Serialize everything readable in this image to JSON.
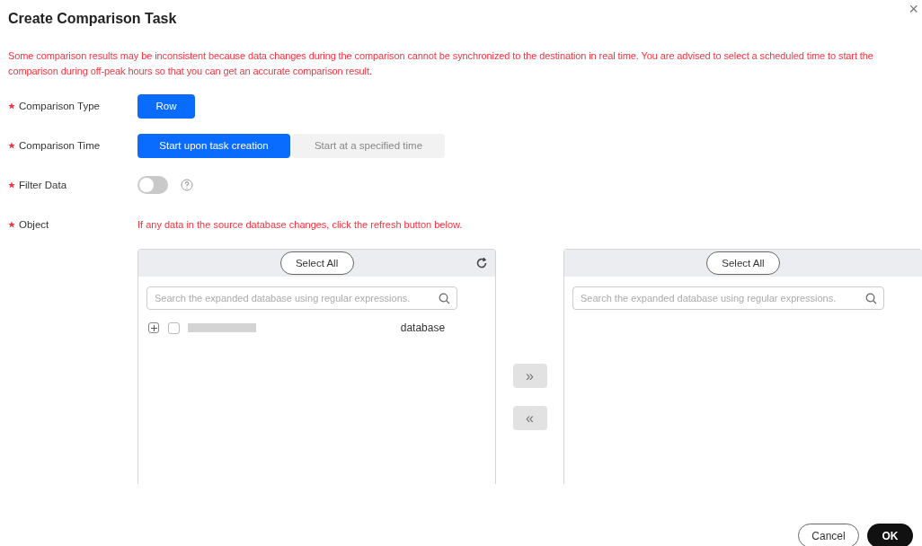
{
  "dialog": {
    "title": "Create Comparison Task",
    "close": "×"
  },
  "warning": "Some comparison results may be inconsistent because data changes during the comparison cannot be synchronized to the destination in real time. You are advised to select a scheduled time to start the comparison during off-peak hours so that you can get an accurate comparison result.",
  "form": {
    "comparison_type": {
      "label": "Comparison Type",
      "required": true,
      "options": [
        {
          "label": "Row",
          "selected": true
        }
      ]
    },
    "comparison_time": {
      "label": "Comparison Time",
      "required": true,
      "options": [
        {
          "label": "Start upon task creation",
          "selected": true
        },
        {
          "label": "Start at a specified time",
          "selected": false
        }
      ]
    },
    "filter_data": {
      "label": "Filter Data",
      "required": true,
      "on": false
    },
    "object": {
      "label": "Object",
      "required": true,
      "hint": "If any data in the source database changes, click the refresh button below."
    }
  },
  "source_panel": {
    "select_all": "Select All",
    "search": {
      "placeholder": "Search the expanded database using regular expressions."
    },
    "items": [
      {
        "expanded": false,
        "checked": false,
        "type": "database"
      }
    ]
  },
  "transfer_buttons": [
    {
      "label": "»",
      "disabled": true
    },
    {
      "label": "«",
      "disabled": true
    }
  ],
  "target_panel": {
    "select_all": "Select All",
    "search": {
      "placeholder": "Search the expanded database using regular expressions."
    }
  },
  "buttons": [
    {
      "label": "Cancel",
      "kind": "secondary"
    },
    {
      "label": "OK",
      "kind": "primary"
    }
  ]
}
